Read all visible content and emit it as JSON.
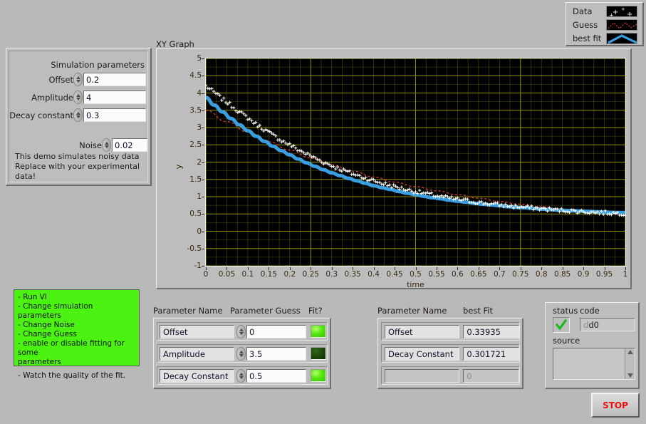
{
  "legend": {
    "rows": [
      {
        "label": "Data",
        "style": "white-scatter-points"
      },
      {
        "label": "Guess",
        "style": "red-dashed-line"
      },
      {
        "label": "best fit",
        "style": "blue-solid-line"
      }
    ]
  },
  "sim_params": {
    "title": "Simulation parameters",
    "fields": [
      {
        "label": "Offset",
        "value": "0.2"
      },
      {
        "label": "Amplitude",
        "value": "4"
      },
      {
        "label": "Decay constant",
        "value": "0.3"
      }
    ],
    "noise": {
      "label": "Noise",
      "value": "0.02"
    },
    "note_line1": "This demo simulates noisy data",
    "note_line2": "Replace with your experimental data!"
  },
  "graph": {
    "title": "XY Graph"
  },
  "chart_data": {
    "type": "scatter",
    "title": "XY Graph",
    "xlabel": "time",
    "ylabel": "y",
    "xlim": [
      0,
      1
    ],
    "ylim": [
      -1,
      5
    ],
    "grid": true,
    "grid_color": "#8f8f00",
    "background": "#000000",
    "xticks": [
      "0",
      "0.05",
      "0.1",
      "0.15",
      "0.2",
      "0.25",
      "0.3",
      "0.35",
      "0.4",
      "0.45",
      "0.5",
      "0.55",
      "0.6",
      "0.65",
      "0.7",
      "0.75",
      "0.8",
      "0.85",
      "0.9",
      "0.95",
      "1"
    ],
    "yticks": [
      "5",
      "4.5",
      "4",
      "3.5",
      "3",
      "2.5",
      "2",
      "1.5",
      "1",
      "0.5",
      "0",
      "-0.5",
      "-1"
    ],
    "legend_position": "top-right-outside",
    "series": [
      {
        "name": "Data",
        "style": "scatter-plus-marker",
        "color": "#ffffff",
        "model": "y = 0.2 + 4*exp(-t/0.3) + noise(0.02)",
        "x": [
          0,
          0.02,
          0.04,
          0.06,
          0.08,
          0.1,
          0.12,
          0.14,
          0.16,
          0.18,
          0.2,
          0.22,
          0.24,
          0.26,
          0.28,
          0.3,
          0.32,
          0.34,
          0.36,
          0.38,
          0.4,
          0.42,
          0.44,
          0.46,
          0.48,
          0.5,
          0.52,
          0.54,
          0.56,
          0.58,
          0.6,
          0.62,
          0.64,
          0.66,
          0.68,
          0.7,
          0.72,
          0.74,
          0.76,
          0.78,
          0.8,
          0.82,
          0.84,
          0.86,
          0.88,
          0.9,
          0.92,
          0.94,
          0.96,
          0.98,
          1
        ],
        "y": [
          4.2,
          4.02,
          3.82,
          3.65,
          3.45,
          3.28,
          3.1,
          2.94,
          2.78,
          2.63,
          2.5,
          2.36,
          2.24,
          2.12,
          2.0,
          1.9,
          1.8,
          1.71,
          1.62,
          1.54,
          1.46,
          1.39,
          1.32,
          1.26,
          1.2,
          1.15,
          1.1,
          1.05,
          1.0,
          0.96,
          0.92,
          0.89,
          0.85,
          0.82,
          0.79,
          0.76,
          0.74,
          0.71,
          0.69,
          0.67,
          0.65,
          0.63,
          0.61,
          0.6,
          0.58,
          0.57,
          0.55,
          0.54,
          0.53,
          0.52,
          0.51
        ]
      },
      {
        "name": "Guess",
        "style": "dashed-line",
        "color": "#e03a3a",
        "model": "y = 0 + 3.5*exp(-t/0.5)",
        "x": [
          0,
          0.05,
          0.1,
          0.15,
          0.2,
          0.25,
          0.3,
          0.35,
          0.4,
          0.45,
          0.5,
          0.55,
          0.6,
          0.65,
          0.7,
          0.75,
          0.8,
          0.85,
          0.9,
          0.95,
          1
        ],
        "y": [
          3.5,
          3.17,
          2.87,
          2.59,
          2.35,
          2.12,
          1.92,
          1.74,
          1.57,
          1.42,
          1.29,
          1.17,
          1.06,
          0.96,
          0.86,
          0.78,
          0.71,
          0.64,
          0.58,
          0.52,
          0.47
        ]
      },
      {
        "name": "best fit",
        "style": "solid-line",
        "color": "#3a9fe0",
        "model": "y = 0.33935 + A*exp(-t/0.301721)",
        "x": [
          0,
          0.02,
          0.04,
          0.06,
          0.08,
          0.1,
          0.12,
          0.14,
          0.16,
          0.18,
          0.2,
          0.22,
          0.24,
          0.26,
          0.28,
          0.3,
          0.32,
          0.34,
          0.36,
          0.38,
          0.4,
          0.42,
          0.44,
          0.46,
          0.48,
          0.5,
          0.52,
          0.54,
          0.56,
          0.58,
          0.6,
          0.62,
          0.64,
          0.66,
          0.68,
          0.7,
          0.72,
          0.74,
          0.76,
          0.78,
          0.8,
          0.82,
          0.84,
          0.86,
          0.88,
          0.9,
          0.92,
          0.94,
          0.96,
          0.98,
          1
        ],
        "y": [
          3.87,
          3.65,
          3.45,
          3.26,
          3.08,
          2.91,
          2.75,
          2.6,
          2.46,
          2.33,
          2.21,
          2.09,
          1.98,
          1.88,
          1.78,
          1.69,
          1.61,
          1.53,
          1.46,
          1.39,
          1.32,
          1.26,
          1.21,
          1.15,
          1.1,
          1.06,
          1.01,
          0.97,
          0.94,
          0.9,
          0.87,
          0.84,
          0.81,
          0.78,
          0.76,
          0.74,
          0.71,
          0.69,
          0.68,
          0.66,
          0.64,
          0.63,
          0.61,
          0.6,
          0.59,
          0.58,
          0.57,
          0.56,
          0.55,
          0.54,
          0.54
        ]
      }
    ]
  },
  "instructions": {
    "lines": [
      "- Run VI",
      "- Change simulation parameters",
      "- Change Noise",
      "- Change Guess",
      "- enable or disable fitting for some",
      "   parameters",
      "",
      "- Watch the quality of the fit."
    ]
  },
  "guess_table": {
    "headers": {
      "name": "Parameter Name",
      "guess": "Parameter Guess",
      "fit": "Fit?"
    },
    "rows": [
      {
        "name": "Offset",
        "guess": "0",
        "fit_on": true
      },
      {
        "name": "Amplitude",
        "guess": "3.5",
        "fit_on": false
      },
      {
        "name": "Decay Constant",
        "guess": "0.5",
        "fit_on": true
      }
    ]
  },
  "fit_table": {
    "headers": {
      "name": "Parameter Name",
      "value": "best Fit"
    },
    "rows": [
      {
        "name": "Offset",
        "value": "0.33935",
        "empty": false
      },
      {
        "name": "Decay Constant",
        "value": "0.301721",
        "empty": false
      },
      {
        "name": "",
        "value": "0",
        "empty": true
      }
    ]
  },
  "error_cluster": {
    "status_label": "status",
    "code_label": "code",
    "code_value": "d0",
    "source_label": "source",
    "source_value": "",
    "status_ok": true
  },
  "stop_button": {
    "label": "STOP"
  },
  "colors": {
    "panel": "#bdbdbd",
    "plot_bg": "#000000",
    "grid": "#8f8f00",
    "data": "#ffffff",
    "guess": "#e03a3a",
    "bestfit": "#3a9fe0",
    "led_on": "#56e810",
    "led_off": "#1d4a0c",
    "instructions_bg": "#4cf211",
    "stop_text": "#ee1111"
  }
}
